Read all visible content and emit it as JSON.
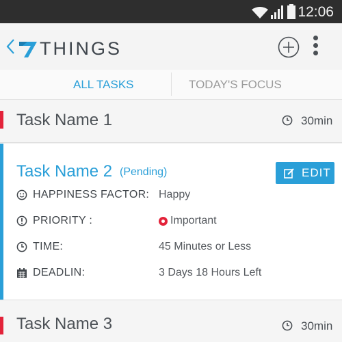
{
  "status_bar": {
    "time": "12:06"
  },
  "app_bar": {
    "logo_text": "THINGS"
  },
  "tabs": [
    {
      "label": "ALL TASKS",
      "active": true
    },
    {
      "label": "TODAY'S FOCUS",
      "active": false
    }
  ],
  "tasks": [
    {
      "name": "Task Name 1",
      "duration": "30min",
      "priority_color": "#e3233a"
    },
    {
      "name": "Task Name 2",
      "status": "(Pending)",
      "edit_label": "EDIT",
      "fields": [
        {
          "icon": "smiley-icon",
          "label": "HAPPINESS FACTOR:",
          "value": "Happy"
        },
        {
          "icon": "alert-icon",
          "label": "PRIORITY :",
          "value": "Important"
        },
        {
          "icon": "clock-icon",
          "label": "TIME:",
          "value": "45 Minutes or Less"
        },
        {
          "icon": "calendar-icon",
          "label": "DEADLIN:",
          "value": "3 Days 18 Hours Left"
        }
      ]
    },
    {
      "name": "Task Name 3",
      "duration": "30min",
      "priority_color": "#e3233a"
    }
  ],
  "colors": {
    "accent": "#2a9fd8",
    "priority": "#e3233a",
    "status_bar": "#2e2e2e"
  }
}
